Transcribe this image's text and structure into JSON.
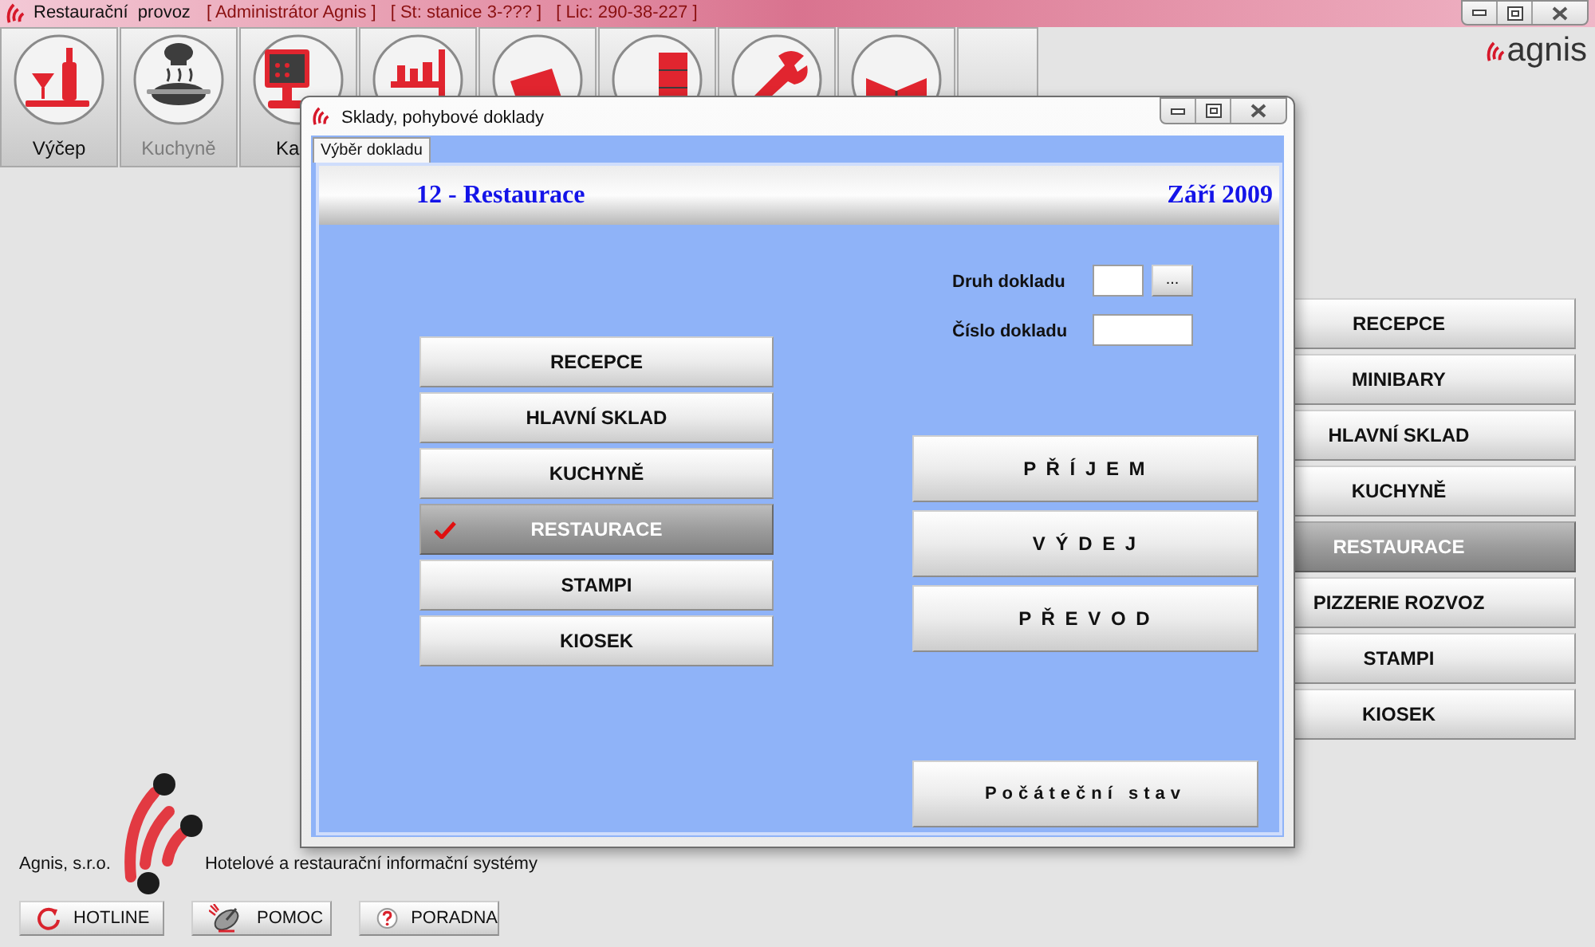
{
  "window": {
    "title": "Restaurační  provoz",
    "tags": [
      "[ Administrátor Agnis ]",
      "[ St: stanice 3-??? ]",
      "[ Lic: 290-38-227 ]"
    ]
  },
  "toolbar": [
    {
      "kind": "icon",
      "label": "Výčep",
      "disabled": false
    },
    {
      "kind": "icon",
      "label": "Kuchyně",
      "disabled": true
    },
    {
      "kind": "covered",
      "label": "Ka",
      "disabled": false
    },
    {
      "kind": "icon",
      "disabled": false
    },
    {
      "kind": "icon",
      "disabled": false
    },
    {
      "kind": "icon",
      "disabled": false
    },
    {
      "kind": "icon",
      "disabled": false
    },
    {
      "kind": "icon",
      "disabled": false
    },
    {
      "kind": "plain"
    }
  ],
  "logo": "agnis",
  "warehouses": [
    {
      "label": "RECEPCE",
      "selected": false
    },
    {
      "label": "MINIBARY",
      "selected": false
    },
    {
      "label": "HLAVNÍ SKLAD",
      "selected": false
    },
    {
      "label": "KUCHYNĚ",
      "selected": false
    },
    {
      "label": "RESTAURACE",
      "selected": true
    },
    {
      "label": "PIZZERIE ROZVOZ",
      "selected": false
    },
    {
      "label": "STAMPI",
      "selected": false
    },
    {
      "label": "KIOSEK",
      "selected": false
    }
  ],
  "dialog": {
    "title": "Sklady, pohybové doklady",
    "tabs": [
      {
        "label": "Výběr dokladu",
        "selected": true
      }
    ],
    "header": {
      "title": "12 - Restaurace",
      "period": "Září 2009"
    },
    "warehouses": [
      {
        "label": "RECEPCE",
        "selected": false
      },
      {
        "label": "HLAVNÍ SKLAD",
        "selected": false
      },
      {
        "label": "KUCHYNĚ",
        "selected": false
      },
      {
        "label": "RESTAURACE",
        "selected": true
      },
      {
        "label": "STAMPI",
        "selected": false
      },
      {
        "label": "KIOSEK",
        "selected": false
      }
    ],
    "fields": [
      {
        "kind": "picker",
        "label": "Druh dokladu",
        "button": "..."
      },
      {
        "kind": "text",
        "label": "Číslo dokladu"
      }
    ],
    "actions": [
      "P Ř Í J E M",
      "V Ý D E J",
      "P Ř E V O D"
    ],
    "initial_state_button": "Počáteční stav"
  },
  "footer": {
    "company": "Agnis, s.r.o.",
    "tagline": "Hotelové a restaurační informační systémy",
    "buttons": [
      "HOTLINE",
      "POMOC",
      "PORADNA"
    ]
  }
}
